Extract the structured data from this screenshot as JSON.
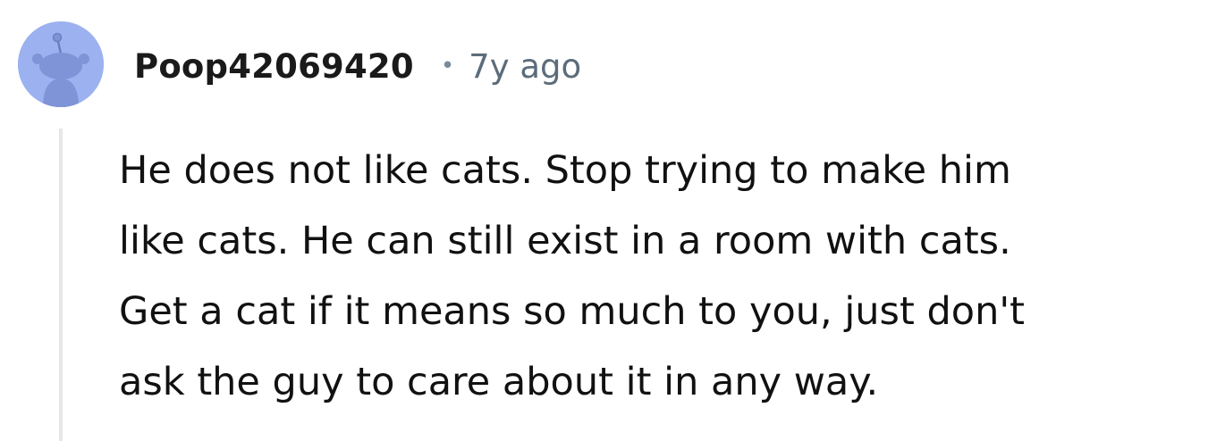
{
  "comment": {
    "username": "Poop42069420",
    "separator": "•",
    "timestamp": "7y ago",
    "body_lines": [
      "He does not like cats. Stop trying to make him",
      "like cats. He can still exist in a room with cats.",
      "Get a cat if it means so much to you, just don't",
      "ask the guy to care about it in any way."
    ]
  },
  "icons": {
    "avatar": "reddit-snoo-avatar-icon"
  },
  "colors": {
    "avatar_background": "#9cb1f0",
    "thread_line": "#e5e7ea",
    "timestamp": "#5c6c7a"
  }
}
